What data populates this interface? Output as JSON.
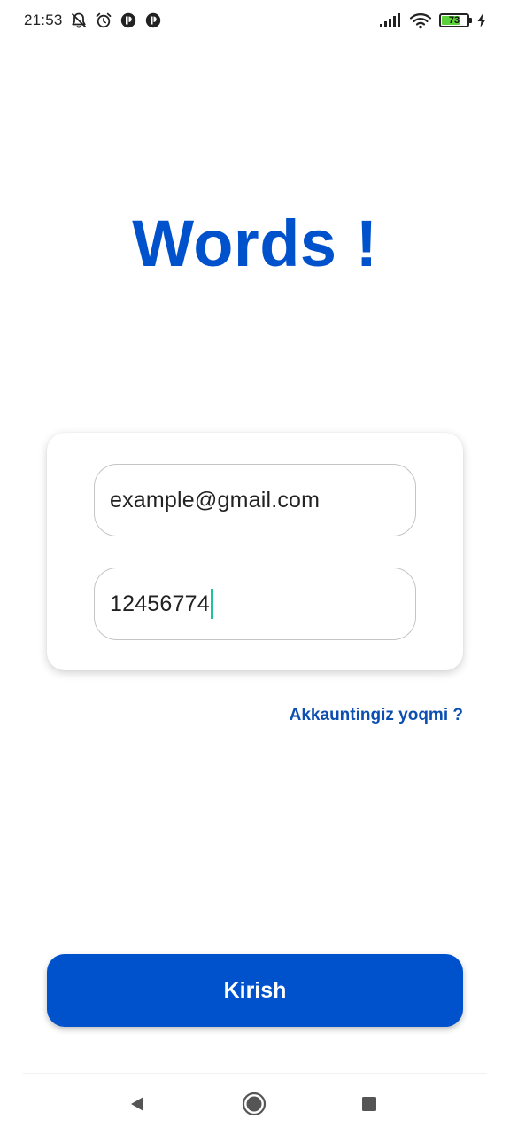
{
  "status_bar": {
    "time": "21:53",
    "battery_level": 73,
    "battery_text": "73",
    "icons": [
      "bell-off-icon",
      "alarm-icon",
      "app-notification-icon",
      "app-notification-icon",
      "signal-icon",
      "wifi-icon",
      "battery-icon",
      "charging-icon"
    ]
  },
  "app": {
    "title": "Words !"
  },
  "login_form": {
    "email_value": "example@gmail.com",
    "password_value": "12456774"
  },
  "signup_link": "Akkauntingiz yoqmi ?",
  "login_button": "Kirish",
  "nav_bar": {
    "icons": [
      "back-icon",
      "home-icon",
      "recents-icon"
    ]
  },
  "colors": {
    "accent": "#0052cc",
    "link": "#0d4fb0",
    "caret": "#1ec3a0",
    "battery_fill": "#5bd13a"
  }
}
